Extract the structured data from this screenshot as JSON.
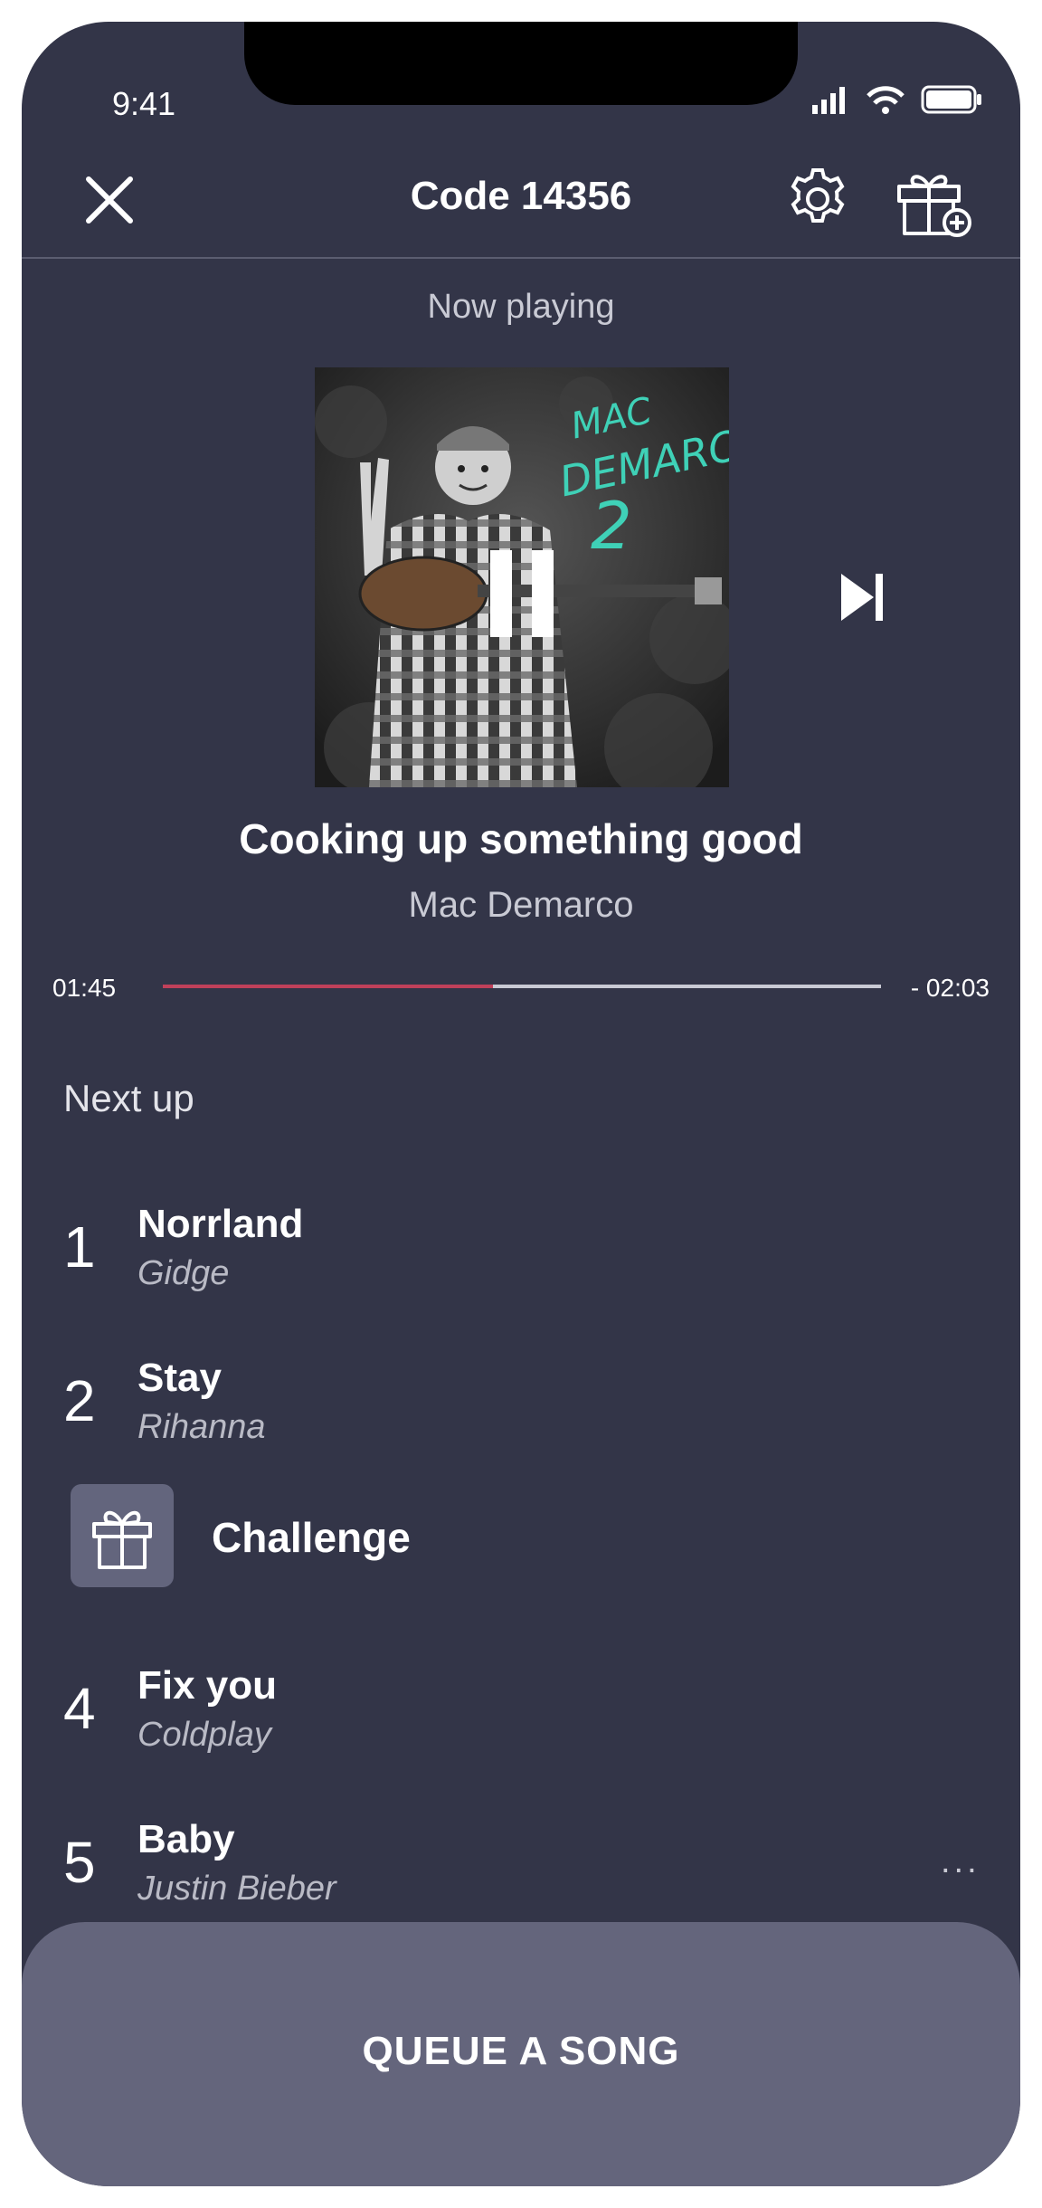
{
  "status_bar": {
    "time": "9:41"
  },
  "header": {
    "title": "Code 14356",
    "close_icon": "close-icon",
    "settings_icon": "gear-icon",
    "gift_icon": "gift-add-icon"
  },
  "now_playing": {
    "label": "Now playing",
    "album_art_text": {
      "line1": "MAC",
      "line2": "DEMARCO",
      "line3": "2"
    },
    "title": "Cooking up something good",
    "artist": "Mac Demarco",
    "elapsed": "01:45",
    "remaining": "- 02:03",
    "progress_fraction": 0.46,
    "accent_color": "#c0405a"
  },
  "next_up": {
    "label": "Next up",
    "tracks": [
      {
        "num": "1",
        "title": "Norrland",
        "artist": "Gidge"
      },
      {
        "num": "2",
        "title": "Stay",
        "artist": "Rihanna"
      },
      {
        "num": "4",
        "title": "Fix you",
        "artist": "Coldplay"
      },
      {
        "num": "5",
        "title": "Baby",
        "artist": "Justin Bieber"
      }
    ],
    "challenge": {
      "label": "Challenge",
      "icon": "gift-icon"
    },
    "more": "..."
  },
  "queue_button": {
    "label": "QUEUE A SONG"
  }
}
